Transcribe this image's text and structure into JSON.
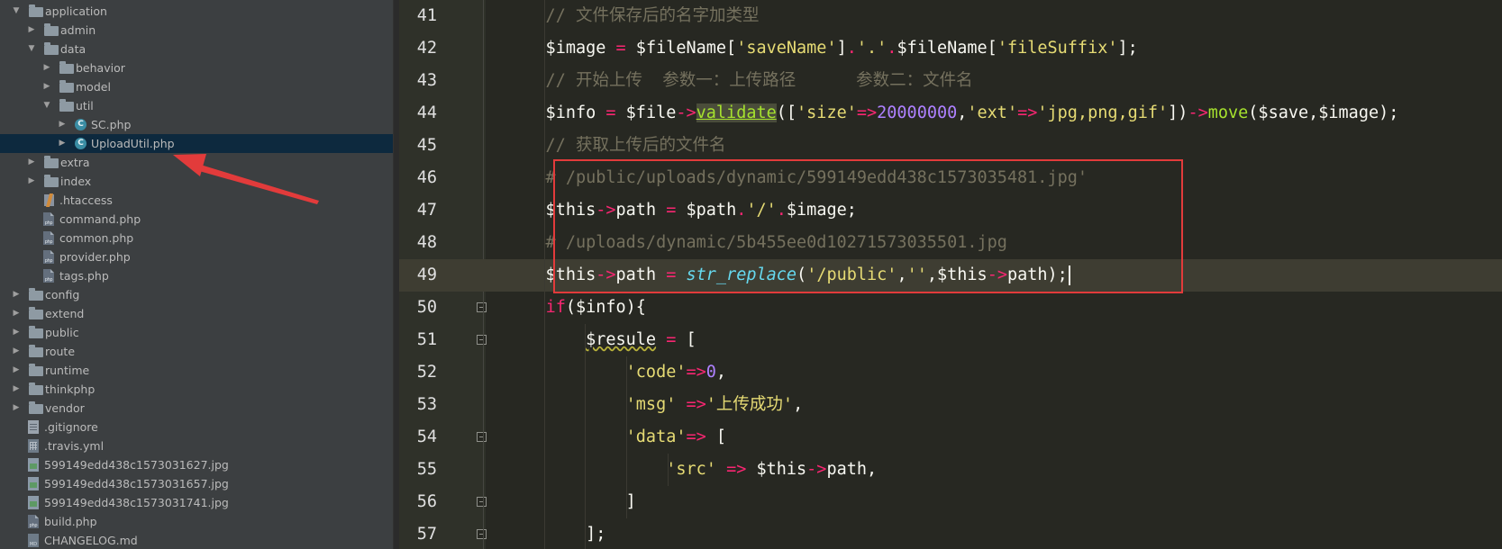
{
  "file_tree": {
    "items": [
      {
        "label": "application",
        "kind": "folder",
        "depth": 0,
        "expanded": true
      },
      {
        "label": "admin",
        "kind": "folder",
        "depth": 1,
        "expanded": false
      },
      {
        "label": "data",
        "kind": "folder",
        "depth": 1,
        "expanded": true
      },
      {
        "label": "behavior",
        "kind": "folder",
        "depth": 2,
        "expanded": false
      },
      {
        "label": "model",
        "kind": "folder",
        "depth": 2,
        "expanded": false
      },
      {
        "label": "util",
        "kind": "folder",
        "depth": 2,
        "expanded": true
      },
      {
        "label": "SC.php",
        "kind": "class",
        "depth": 3,
        "expanded": false
      },
      {
        "label": "UploadUtil.php",
        "kind": "class",
        "depth": 3,
        "expanded": false,
        "selected": true
      },
      {
        "label": "extra",
        "kind": "folder",
        "depth": 1,
        "expanded": false
      },
      {
        "label": "index",
        "kind": "folder",
        "depth": 1,
        "expanded": false
      },
      {
        "label": ".htaccess",
        "kind": "htaccess",
        "depth": 1
      },
      {
        "label": "command.php",
        "kind": "php",
        "depth": 1
      },
      {
        "label": "common.php",
        "kind": "php",
        "depth": 1
      },
      {
        "label": "provider.php",
        "kind": "php",
        "depth": 1
      },
      {
        "label": "tags.php",
        "kind": "php",
        "depth": 1
      },
      {
        "label": "config",
        "kind": "folder",
        "depth": 0,
        "expanded": false
      },
      {
        "label": "extend",
        "kind": "folder",
        "depth": 0,
        "expanded": false
      },
      {
        "label": "public",
        "kind": "folder",
        "depth": 0,
        "expanded": false
      },
      {
        "label": "route",
        "kind": "folder",
        "depth": 0,
        "expanded": false
      },
      {
        "label": "runtime",
        "kind": "folder",
        "depth": 0,
        "expanded": false
      },
      {
        "label": "thinkphp",
        "kind": "folder",
        "depth": 0,
        "expanded": false
      },
      {
        "label": "vendor",
        "kind": "folder",
        "depth": 0,
        "expanded": false
      },
      {
        "label": ".gitignore",
        "kind": "text",
        "depth": 0
      },
      {
        "label": ".travis.yml",
        "kind": "yml",
        "depth": 0
      },
      {
        "label": "599149edd438c1573031627.jpg",
        "kind": "image",
        "depth": 0
      },
      {
        "label": "599149edd438c1573031657.jpg",
        "kind": "image",
        "depth": 0
      },
      {
        "label": "599149edd438c1573031741.jpg",
        "kind": "image",
        "depth": 0
      },
      {
        "label": "build.php",
        "kind": "php",
        "depth": 0
      },
      {
        "label": "CHANGELOG.md",
        "kind": "md",
        "depth": 0
      }
    ]
  },
  "editor": {
    "current_line": 49,
    "fold_markers": [
      50,
      51,
      54,
      56,
      57
    ],
    "lines": [
      {
        "no": "41",
        "tokens": [
          [
            "    // 文件保存后的名字加类型",
            "cm"
          ]
        ]
      },
      {
        "no": "42",
        "tokens": [
          [
            "    $image ",
            ""
          ],
          [
            "=",
            "kw"
          ],
          [
            " $fileName[",
            ""
          ],
          [
            "'saveName'",
            "str"
          ],
          [
            "]",
            ""
          ],
          [
            ".",
            "kw"
          ],
          [
            "'.'",
            "str"
          ],
          [
            ".",
            "kw"
          ],
          [
            "$fileName[",
            ""
          ],
          [
            "'fileSuffix'",
            "str"
          ],
          [
            "];",
            ""
          ]
        ]
      },
      {
        "no": "43",
        "tokens": [
          [
            "    // 开始上传  参数一：上传路径      参数二：文件名",
            "cm"
          ]
        ]
      },
      {
        "no": "44",
        "tokens": [
          [
            "    $info ",
            ""
          ],
          [
            "=",
            "kw"
          ],
          [
            " $file",
            ""
          ],
          [
            "->",
            "kw"
          ],
          [
            "validate",
            "hl"
          ],
          [
            "([",
            ""
          ],
          [
            "'size'",
            "str"
          ],
          [
            "=>",
            "kw"
          ],
          [
            "20000000",
            "num"
          ],
          [
            ",",
            ""
          ],
          [
            "'ext'",
            "str"
          ],
          [
            "=>",
            "kw"
          ],
          [
            "'jpg,png,gif'",
            "str"
          ],
          [
            "])",
            ""
          ],
          [
            "->",
            "kw"
          ],
          [
            "move",
            "fn"
          ],
          [
            "($save,$image);",
            ""
          ]
        ]
      },
      {
        "no": "45",
        "tokens": [
          [
            "    // 获取上传后的文件名",
            "cm"
          ]
        ]
      },
      {
        "no": "46",
        "tokens": [
          [
            "    # /public/uploads/dynamic/599149edd438c1573035481.jpg'",
            "cm"
          ]
        ]
      },
      {
        "no": "47",
        "tokens": [
          [
            "    $this",
            ""
          ],
          [
            "->",
            "kw"
          ],
          [
            "path ",
            ""
          ],
          [
            "=",
            "kw"
          ],
          [
            " $path",
            ""
          ],
          [
            ".",
            "kw"
          ],
          [
            "'/'",
            "str"
          ],
          [
            ".",
            "kw"
          ],
          [
            "$image;",
            ""
          ]
        ]
      },
      {
        "no": "48",
        "tokens": [
          [
            "    # /uploads/dynamic/5b455ee0d10271573035501.jpg",
            "cm"
          ]
        ]
      },
      {
        "no": "49",
        "tokens": [
          [
            "    $this",
            ""
          ],
          [
            "->",
            "kw"
          ],
          [
            "path ",
            ""
          ],
          [
            "=",
            "kw"
          ],
          [
            " ",
            ""
          ],
          [
            "str_replace",
            "call"
          ],
          [
            "(",
            ""
          ],
          [
            "'/public'",
            "str"
          ],
          [
            ",",
            ""
          ],
          [
            "''",
            "str"
          ],
          [
            ",$this",
            ""
          ],
          [
            "->",
            "kw"
          ],
          [
            "path);",
            ""
          ]
        ],
        "caret": true
      },
      {
        "no": "50",
        "tokens": [
          [
            "    ",
            ""
          ],
          [
            "if",
            "kw"
          ],
          [
            "($info){",
            ""
          ]
        ]
      },
      {
        "no": "51",
        "tokens": [
          [
            "        ",
            ""
          ],
          [
            "$resule",
            "warn"
          ],
          [
            " ",
            ""
          ],
          [
            "=",
            "kw"
          ],
          [
            " [",
            ""
          ]
        ]
      },
      {
        "no": "52",
        "tokens": [
          [
            "            ",
            ""
          ],
          [
            "'code'",
            "str"
          ],
          [
            "=>",
            "kw"
          ],
          [
            "0",
            "num"
          ],
          [
            ",",
            ""
          ]
        ]
      },
      {
        "no": "53",
        "tokens": [
          [
            "            ",
            ""
          ],
          [
            "'msg'",
            "str"
          ],
          [
            " ",
            ""
          ],
          [
            "=>",
            "kw"
          ],
          [
            "'上传成功'",
            "str"
          ],
          [
            ",",
            ""
          ]
        ]
      },
      {
        "no": "54",
        "tokens": [
          [
            "            ",
            ""
          ],
          [
            "'data'",
            "str"
          ],
          [
            "=>",
            "kw"
          ],
          [
            " [",
            ""
          ]
        ]
      },
      {
        "no": "55",
        "tokens": [
          [
            "                ",
            ""
          ],
          [
            "'src'",
            "str"
          ],
          [
            " ",
            ""
          ],
          [
            "=>",
            "kw"
          ],
          [
            " $this",
            ""
          ],
          [
            "->",
            "kw"
          ],
          [
            "path,",
            ""
          ]
        ]
      },
      {
        "no": "56",
        "tokens": [
          [
            "            ]",
            ""
          ]
        ]
      },
      {
        "no": "57",
        "tokens": [
          [
            "        ];",
            ""
          ]
        ]
      }
    ]
  },
  "annotation": {
    "box_color": "#e23b3b",
    "arrow_color": "#e23b3b"
  }
}
